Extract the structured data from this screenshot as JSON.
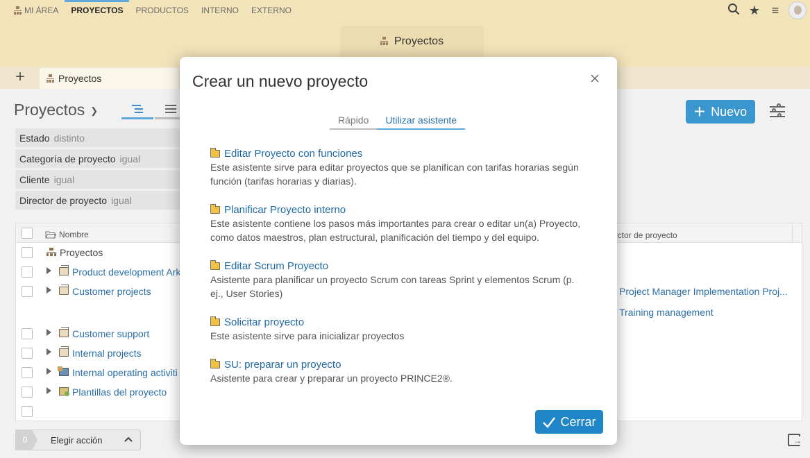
{
  "topnav": {
    "items": [
      {
        "label": "MI ÁREA",
        "active": false
      },
      {
        "label": "PROYECTOS",
        "active": true
      },
      {
        "label": "PRODUCTOS",
        "active": false
      },
      {
        "label": "INTERNO",
        "active": false
      },
      {
        "label": "EXTERNO",
        "active": false
      }
    ],
    "icons": [
      "search-icon",
      "star-icon",
      "hamburger-menu-icon",
      "user-avatar"
    ]
  },
  "center_tab": {
    "label": "Proyectos"
  },
  "doc_tab": {
    "label": "Proyectos"
  },
  "page": {
    "title": "Proyectos",
    "new_button": "Nuevo"
  },
  "filters": [
    {
      "name": "Estado",
      "op": "distinto"
    },
    {
      "name": "Categoría de proyecto",
      "op": "igual"
    },
    {
      "name": "Cliente",
      "op": "igual"
    },
    {
      "name": "Director de proyecto",
      "op": "igual"
    }
  ],
  "table": {
    "headers": {
      "name": "Nombre",
      "director": "ector de proyecto"
    },
    "rows": [
      {
        "label": "Proyectos",
        "director": ""
      },
      {
        "label": "Product development Ark",
        "director": ""
      },
      {
        "label": "Customer projects",
        "director": "Project Manager Implementation Proj..."
      },
      {
        "label": "",
        "director": "Training management"
      },
      {
        "label": "Customer support",
        "director": ""
      },
      {
        "label": "Internal projects",
        "director": ""
      },
      {
        "label": "Internal operating activiti",
        "director": ""
      },
      {
        "label": "Plantillas del proyecto",
        "director": ""
      }
    ]
  },
  "footer": {
    "count": "0",
    "action_label": "Elegir acción"
  },
  "modal": {
    "title": "Crear un nuevo proyecto",
    "tabs": [
      {
        "label": "Rápido",
        "active": false
      },
      {
        "label": "Utilizar asistente",
        "active": true
      }
    ],
    "wizards": [
      {
        "title": "Editar Proyecto con funciones",
        "desc": "Este asistente sirve para editar proyectos que se planifican con tarifas horarias según función (tarifas horarias y diarias)."
      },
      {
        "title": "Planificar Proyecto interno",
        "desc": "Este asistente contiene los pasos más importantes para crear o editar un(a) Proyecto, como datos maestros, plan estructural, planificación del tiempo y del equipo."
      },
      {
        "title": "Editar Scrum Proyecto",
        "desc": "Asistente para planificar un proyecto Scrum con tareas Sprint y elementos Scrum (p. ej., User Stories)"
      },
      {
        "title": "Solicitar proyecto",
        "desc": "Este asistente sirve para inicializar proyectos"
      },
      {
        "title": "SU: preparar un proyecto",
        "desc": "Asistente para crear y preparar un proyecto PRINCE2®."
      }
    ],
    "close_button": "Cerrar"
  },
  "colors": {
    "header_bg": "#f3e3b9",
    "accent": "#3a96cf",
    "link": "#2a6fa8"
  }
}
